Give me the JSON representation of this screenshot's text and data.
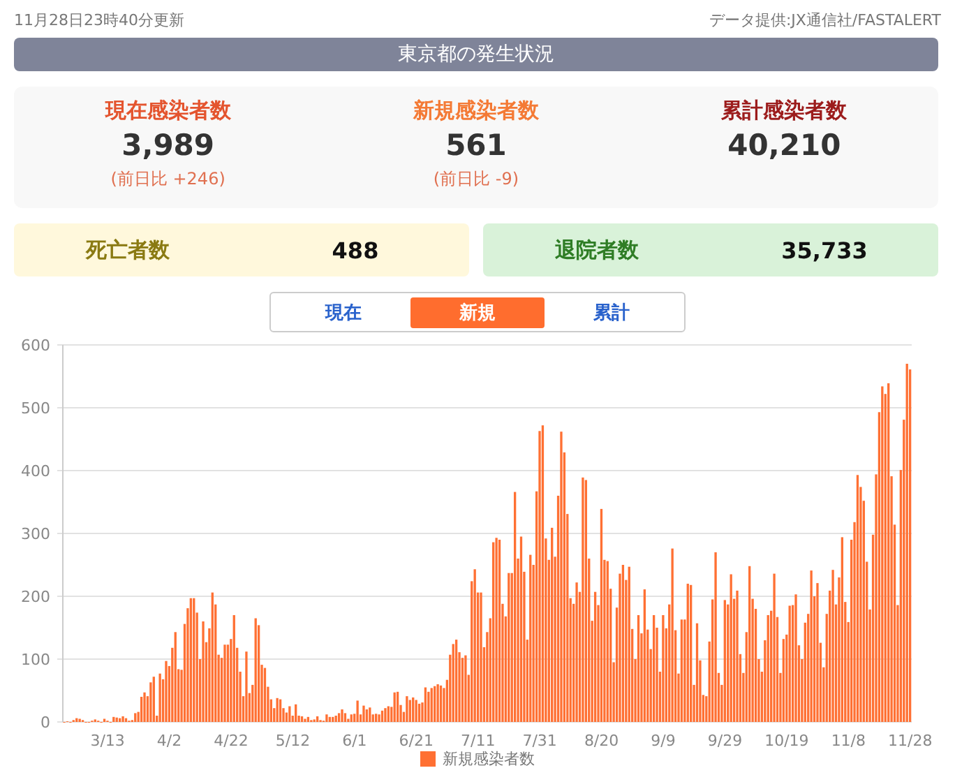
{
  "header": {
    "updated": "11月28日23時40分更新",
    "source": "データ提供:JX通信社/FASTALERT"
  },
  "title": "東京都の発生状況",
  "stats": [
    {
      "kind": "current",
      "label": "現在感染者数",
      "value": "3,989",
      "change": "(前日比 +246)"
    },
    {
      "kind": "new",
      "label": "新規感染者数",
      "value": "561",
      "change": "(前日比 -9)"
    },
    {
      "kind": "cumulative",
      "label": "累計感染者数",
      "value": "40,210"
    }
  ],
  "totals": [
    {
      "kind": "deaths",
      "label": "死亡者数",
      "value": "488"
    },
    {
      "kind": "discharged",
      "label": "退院者数",
      "value": "35,733"
    }
  ],
  "tabs": [
    {
      "label": "現在",
      "selected": false
    },
    {
      "label": "新規",
      "selected": true
    },
    {
      "label": "累計",
      "selected": false
    }
  ],
  "chart": {
    "chart_data": {
      "type": "bar",
      "grid": true,
      "ylim": [
        0,
        600
      ],
      "yticks": [
        0,
        100,
        200,
        300,
        400,
        500,
        600
      ],
      "categories": [
        null,
        null,
        null,
        null,
        null,
        null,
        null,
        null,
        null,
        null,
        null,
        null,
        null,
        null,
        "3/13",
        null,
        null,
        null,
        null,
        null,
        null,
        null,
        null,
        null,
        null,
        null,
        null,
        null,
        null,
        null,
        null,
        null,
        null,
        null,
        "4/2",
        null,
        null,
        null,
        null,
        null,
        null,
        null,
        null,
        null,
        null,
        null,
        null,
        null,
        null,
        null,
        null,
        null,
        null,
        null,
        "4/22",
        null,
        null,
        null,
        null,
        null,
        null,
        null,
        null,
        null,
        null,
        null,
        null,
        null,
        null,
        null,
        null,
        null,
        null,
        null,
        "5/12",
        null,
        null,
        null,
        null,
        null,
        null,
        null,
        null,
        null,
        null,
        null,
        null,
        null,
        null,
        null,
        null,
        null,
        null,
        null,
        "6/1",
        null,
        null,
        null,
        null,
        null,
        null,
        null,
        null,
        null,
        null,
        null,
        null,
        null,
        null,
        null,
        null,
        null,
        null,
        null,
        "6/21",
        null,
        null,
        null,
        null,
        null,
        null,
        null,
        null,
        null,
        null,
        null,
        null,
        null,
        null,
        null,
        null,
        null,
        null,
        null,
        "7/11",
        null,
        null,
        null,
        null,
        null,
        null,
        null,
        null,
        null,
        null,
        null,
        null,
        null,
        null,
        null,
        null,
        null,
        null,
        null,
        "7/31",
        null,
        null,
        null,
        null,
        null,
        null,
        null,
        null,
        null,
        null,
        null,
        null,
        null,
        null,
        null,
        null,
        null,
        null,
        null,
        "8/20",
        null,
        null,
        null,
        null,
        null,
        null,
        null,
        null,
        null,
        null,
        null,
        null,
        null,
        null,
        null,
        null,
        null,
        null,
        null,
        "9/9",
        null,
        null,
        null,
        null,
        null,
        null,
        null,
        null,
        null,
        null,
        null,
        null,
        null,
        null,
        null,
        null,
        null,
        null,
        null,
        "9/29",
        null,
        null,
        null,
        null,
        null,
        null,
        null,
        null,
        null,
        null,
        null,
        null,
        null,
        null,
        null,
        null,
        null,
        null,
        null,
        "10/19",
        null,
        null,
        null,
        null,
        null,
        null,
        null,
        null,
        null,
        null,
        null,
        null,
        null,
        null,
        null,
        null,
        null,
        null,
        null,
        "11/8",
        null,
        null,
        null,
        null,
        null,
        null,
        null,
        null,
        null,
        null,
        null,
        null,
        null,
        null,
        null,
        null,
        null,
        null,
        null,
        "11/28"
      ],
      "series": [
        {
          "name": "新規感染者数",
          "color": "#ff7033",
          "values": [
            0,
            1,
            0,
            3,
            6,
            5,
            3,
            0,
            0,
            2,
            4,
            2,
            0,
            5,
            2,
            0,
            8,
            7,
            6,
            9,
            6,
            2,
            3,
            14,
            16,
            40,
            47,
            41,
            63,
            72,
            10,
            77,
            68,
            97,
            89,
            118,
            143,
            84,
            83,
            156,
            181,
            197,
            197,
            174,
            100,
            160,
            127,
            149,
            206,
            187,
            107,
            102,
            123,
            123,
            132,
            170,
            118,
            80,
            41,
            112,
            46,
            59,
            165,
            154,
            91,
            86,
            56,
            36,
            22,
            38,
            36,
            22,
            15,
            25,
            10,
            28,
            10,
            9,
            5,
            8,
            3,
            4,
            9,
            3,
            2,
            12,
            8,
            8,
            10,
            14,
            20,
            14,
            5,
            12,
            13,
            34,
            12,
            26,
            20,
            23,
            12,
            13,
            12,
            18,
            22,
            25,
            24,
            47,
            48,
            27,
            16,
            41,
            35,
            39,
            35,
            29,
            31,
            55,
            48,
            54,
            57,
            60,
            58,
            54,
            67,
            107,
            124,
            131,
            111,
            102,
            106,
            75,
            224,
            243,
            206,
            206,
            119,
            143,
            165,
            286,
            293,
            290,
            188,
            168,
            237,
            237,
            366,
            260,
            295,
            239,
            131,
            266,
            250,
            367,
            463,
            472,
            292,
            258,
            309,
            263,
            360,
            462,
            429,
            331,
            197,
            188,
            222,
            207,
            389,
            385,
            260,
            161,
            207,
            186,
            339,
            258,
            256,
            212,
            95,
            182,
            236,
            250,
            226,
            247,
            148,
            100,
            170,
            141,
            211,
            147,
            116,
            170,
            150,
            80,
            170,
            149,
            187,
            276,
            146,
            77,
            163,
            163,
            220,
            218,
            59,
            157,
            98,
            43,
            41,
            128,
            195,
            270,
            78,
            59,
            194,
            187,
            235,
            196,
            209,
            108,
            78,
            143,
            248,
            196,
            180,
            100,
            80,
            130,
            170,
            177,
            236,
            167,
            78,
            132,
            139,
            185,
            186,
            203,
            122,
            100,
            158,
            172,
            241,
            200,
            221,
            126,
            87,
            172,
            209,
            242,
            187,
            230,
            294,
            191,
            159,
            290,
            318,
            393,
            374,
            352,
            255,
            179,
            298,
            394,
            493,
            534,
            522,
            539,
            391,
            314,
            186,
            401,
            481,
            570,
            561
          ]
        }
      ]
    }
  }
}
